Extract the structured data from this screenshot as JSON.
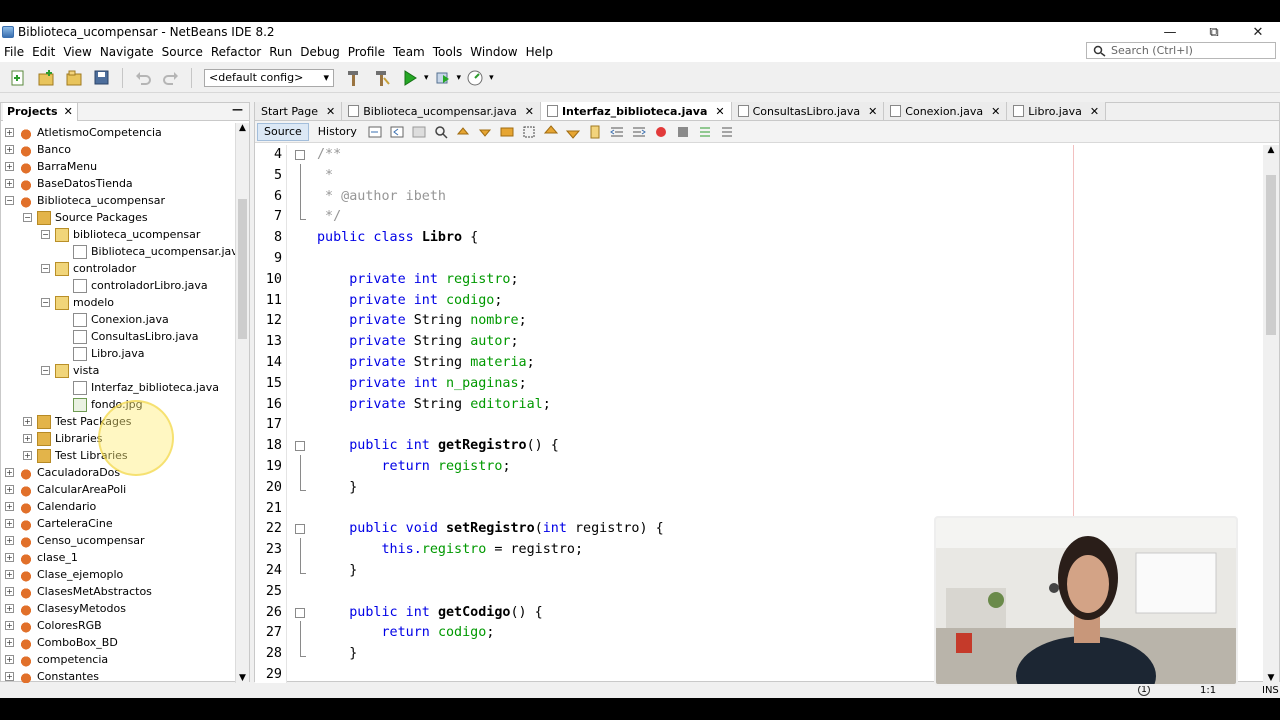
{
  "window": {
    "title": "Biblioteca_ucompensar - NetBeans IDE 8.2",
    "minimize": "—",
    "maximize": "⧉",
    "close": "✕"
  },
  "menu": [
    "File",
    "Edit",
    "View",
    "Navigate",
    "Source",
    "Refactor",
    "Run",
    "Debug",
    "Profile",
    "Team",
    "Tools",
    "Window",
    "Help"
  ],
  "search": {
    "placeholder": "Search (Ctrl+I)"
  },
  "toolbar": {
    "config": "<default config>"
  },
  "projects": {
    "title": "Projects",
    "close": "✕",
    "minimize": "—",
    "tree": [
      {
        "label": "AtletismoCompetencia",
        "type": "project",
        "toggle": "+",
        "level": 0
      },
      {
        "label": "Banco",
        "type": "project",
        "toggle": "+",
        "level": 0
      },
      {
        "label": "BarraMenu",
        "type": "project",
        "toggle": "+",
        "level": 0
      },
      {
        "label": "BaseDatosTienda",
        "type": "project",
        "toggle": "+",
        "level": 0
      },
      {
        "label": "Biblioteca_ucompensar",
        "type": "project",
        "toggle": "−",
        "level": 0
      },
      {
        "label": "Source Packages",
        "type": "pkgfolder",
        "toggle": "−",
        "level": 1
      },
      {
        "label": "biblioteca_ucompensar",
        "type": "package",
        "toggle": "−",
        "level": 2
      },
      {
        "label": "Biblioteca_ucompensar.java",
        "type": "java",
        "toggle": "",
        "level": 3
      },
      {
        "label": "controlador",
        "type": "package",
        "toggle": "−",
        "level": 2
      },
      {
        "label": "controladorLibro.java",
        "type": "java",
        "toggle": "",
        "level": 3
      },
      {
        "label": "modelo",
        "type": "package",
        "toggle": "−",
        "level": 2
      },
      {
        "label": "Conexion.java",
        "type": "java",
        "toggle": "",
        "level": 3
      },
      {
        "label": "ConsultasLibro.java",
        "type": "java",
        "toggle": "",
        "level": 3
      },
      {
        "label": "Libro.java",
        "type": "java",
        "toggle": "",
        "level": 3
      },
      {
        "label": "vista",
        "type": "package",
        "toggle": "−",
        "level": 2
      },
      {
        "label": "Interfaz_biblioteca.java",
        "type": "java",
        "toggle": "",
        "level": 3
      },
      {
        "label": "fondo.jpg",
        "type": "image",
        "toggle": "",
        "level": 3
      },
      {
        "label": "Test Packages",
        "type": "pkgfolder",
        "toggle": "+",
        "level": 1
      },
      {
        "label": "Libraries",
        "type": "pkgfolder",
        "toggle": "+",
        "level": 1
      },
      {
        "label": "Test Libraries",
        "type": "pkgfolder",
        "toggle": "+",
        "level": 1
      },
      {
        "label": "CaculadoraDos",
        "type": "project",
        "toggle": "+",
        "level": 0
      },
      {
        "label": "CalcularAreaPoli",
        "type": "project",
        "toggle": "+",
        "level": 0
      },
      {
        "label": "Calendario",
        "type": "project",
        "toggle": "+",
        "level": 0
      },
      {
        "label": "CarteleraCine",
        "type": "project",
        "toggle": "+",
        "level": 0
      },
      {
        "label": "Censo_ucompensar",
        "type": "project",
        "toggle": "+",
        "level": 0
      },
      {
        "label": "clase_1",
        "type": "project",
        "toggle": "+",
        "level": 0
      },
      {
        "label": "Clase_ejemoplo",
        "type": "project",
        "toggle": "+",
        "level": 0
      },
      {
        "label": "ClasesMetAbstractos",
        "type": "project",
        "toggle": "+",
        "level": 0
      },
      {
        "label": "ClasesyMetodos",
        "type": "project",
        "toggle": "+",
        "level": 0
      },
      {
        "label": "ColoresRGB",
        "type": "project",
        "toggle": "+",
        "level": 0
      },
      {
        "label": "ComboBox_BD",
        "type": "project",
        "toggle": "+",
        "level": 0
      },
      {
        "label": "competencia",
        "type": "project",
        "toggle": "+",
        "level": 0
      },
      {
        "label": "Constantes",
        "type": "project",
        "toggle": "+",
        "level": 0
      }
    ]
  },
  "editor": {
    "tabs": [
      {
        "label": "Start Page",
        "active": false,
        "icon": false
      },
      {
        "label": "Biblioteca_ucompensar.java",
        "active": false,
        "icon": true
      },
      {
        "label": "Interfaz_biblioteca.java",
        "active": true,
        "icon": true
      },
      {
        "label": "ConsultasLibro.java",
        "active": false,
        "icon": true
      },
      {
        "label": "Conexion.java",
        "active": false,
        "icon": true
      },
      {
        "label": "Libro.java",
        "active": false,
        "icon": true
      }
    ],
    "tab_close": "✕",
    "source_label": "Source",
    "history_label": "History",
    "lines": [
      {
        "n": "4",
        "fold": "box",
        "parts": [
          {
            "t": "/**",
            "c": "cm"
          }
        ]
      },
      {
        "n": "5",
        "fold": "line",
        "parts": [
          {
            "t": " *",
            "c": "cm"
          }
        ]
      },
      {
        "n": "6",
        "fold": "line",
        "parts": [
          {
            "t": " * @author ibeth",
            "c": "cm"
          }
        ]
      },
      {
        "n": "7",
        "fold": "end",
        "parts": [
          {
            "t": " */",
            "c": "cm"
          }
        ]
      },
      {
        "n": "8",
        "fold": "",
        "parts": [
          {
            "t": "public class ",
            "c": "kw"
          },
          {
            "t": "Libro",
            "c": "mt"
          },
          {
            "t": " {",
            "c": ""
          }
        ]
      },
      {
        "n": "9",
        "fold": "",
        "parts": []
      },
      {
        "n": "10",
        "fold": "",
        "parts": [
          {
            "t": "    private int ",
            "c": "kw"
          },
          {
            "t": "registro",
            "c": "fld"
          },
          {
            "t": ";",
            "c": ""
          }
        ]
      },
      {
        "n": "11",
        "fold": "",
        "parts": [
          {
            "t": "    private int ",
            "c": "kw"
          },
          {
            "t": "codigo",
            "c": "fld"
          },
          {
            "t": ";",
            "c": ""
          }
        ]
      },
      {
        "n": "12",
        "fold": "",
        "parts": [
          {
            "t": "    private ",
            "c": "kw"
          },
          {
            "t": "String ",
            "c": ""
          },
          {
            "t": "nombre",
            "c": "fld"
          },
          {
            "t": ";",
            "c": ""
          }
        ]
      },
      {
        "n": "13",
        "fold": "",
        "parts": [
          {
            "t": "    private ",
            "c": "kw"
          },
          {
            "t": "String ",
            "c": ""
          },
          {
            "t": "autor",
            "c": "fld"
          },
          {
            "t": ";",
            "c": ""
          }
        ]
      },
      {
        "n": "14",
        "fold": "",
        "parts": [
          {
            "t": "    private ",
            "c": "kw"
          },
          {
            "t": "String ",
            "c": ""
          },
          {
            "t": "materia",
            "c": "fld"
          },
          {
            "t": ";",
            "c": ""
          }
        ]
      },
      {
        "n": "15",
        "fold": "",
        "parts": [
          {
            "t": "    private int ",
            "c": "kw"
          },
          {
            "t": "n_paginas",
            "c": "fld"
          },
          {
            "t": ";",
            "c": ""
          }
        ]
      },
      {
        "n": "16",
        "fold": "",
        "parts": [
          {
            "t": "    private ",
            "c": "kw"
          },
          {
            "t": "String ",
            "c": ""
          },
          {
            "t": "editorial",
            "c": "fld"
          },
          {
            "t": ";",
            "c": ""
          }
        ]
      },
      {
        "n": "17",
        "fold": "",
        "parts": []
      },
      {
        "n": "18",
        "fold": "box",
        "parts": [
          {
            "t": "    public int ",
            "c": "kw"
          },
          {
            "t": "getRegistro",
            "c": "mt"
          },
          {
            "t": "() {",
            "c": ""
          }
        ]
      },
      {
        "n": "19",
        "fold": "line",
        "parts": [
          {
            "t": "        return ",
            "c": "kw"
          },
          {
            "t": "registro",
            "c": "fld"
          },
          {
            "t": ";",
            "c": ""
          }
        ]
      },
      {
        "n": "20",
        "fold": "end",
        "parts": [
          {
            "t": "    }",
            "c": ""
          }
        ]
      },
      {
        "n": "21",
        "fold": "",
        "parts": []
      },
      {
        "n": "22",
        "fold": "box",
        "parts": [
          {
            "t": "    public void ",
            "c": "kw"
          },
          {
            "t": "setRegistro",
            "c": "mt"
          },
          {
            "t": "(",
            "c": ""
          },
          {
            "t": "int ",
            "c": "kw"
          },
          {
            "t": "registro) {",
            "c": ""
          }
        ]
      },
      {
        "n": "23",
        "fold": "line",
        "parts": [
          {
            "t": "        this.",
            "c": "kw"
          },
          {
            "t": "registro",
            "c": "fld"
          },
          {
            "t": " = registro;",
            "c": ""
          }
        ]
      },
      {
        "n": "24",
        "fold": "end",
        "parts": [
          {
            "t": "    }",
            "c": ""
          }
        ]
      },
      {
        "n": "25",
        "fold": "",
        "parts": []
      },
      {
        "n": "26",
        "fold": "box",
        "parts": [
          {
            "t": "    public int ",
            "c": "kw"
          },
          {
            "t": "getCodigo",
            "c": "mt"
          },
          {
            "t": "() {",
            "c": ""
          }
        ]
      },
      {
        "n": "27",
        "fold": "line",
        "parts": [
          {
            "t": "        return ",
            "c": "kw"
          },
          {
            "t": "codigo",
            "c": "fld"
          },
          {
            "t": ";",
            "c": ""
          }
        ]
      },
      {
        "n": "28",
        "fold": "end",
        "parts": [
          {
            "t": "    }",
            "c": ""
          }
        ]
      },
      {
        "n": "29",
        "fold": "",
        "parts": []
      }
    ]
  },
  "status": {
    "notifications": "1",
    "position": "1:1",
    "mode": "INS"
  },
  "colors": {
    "keyword": "#0000e6",
    "field": "#009900",
    "comment": "#969696",
    "active_tab": "#ffffff"
  }
}
